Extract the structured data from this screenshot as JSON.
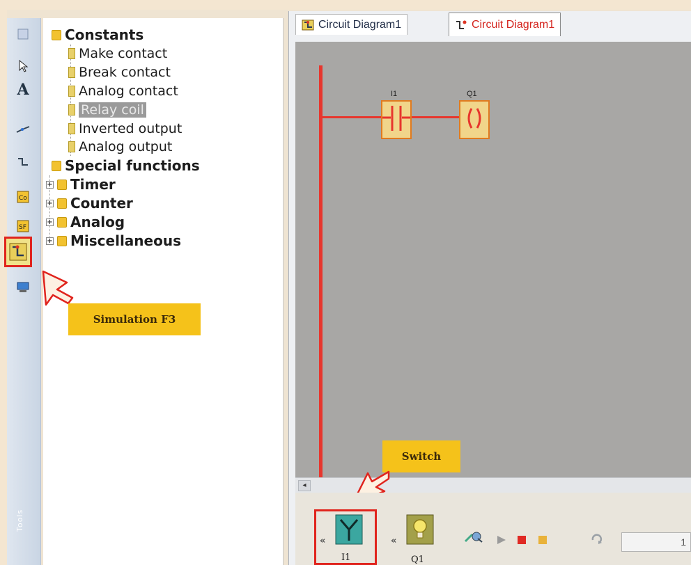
{
  "tabs": [
    {
      "label": "Circuit Diagram1",
      "active": false
    },
    {
      "label": "Circuit Diagram1",
      "active": true
    }
  ],
  "toolbar": {
    "tools_label": "Tools",
    "icons": [
      "select-icon",
      "pointer-icon",
      "text-icon",
      "connect-icon",
      "split-icon",
      "constants-icon",
      "special-functions-icon",
      "simulation-icon",
      "online-test-icon"
    ]
  },
  "tree": {
    "constants": "Constants",
    "items": [
      {
        "label": "Make contact",
        "highlighted": false
      },
      {
        "label": "Break contact",
        "highlighted": false
      },
      {
        "label": "Analog contact",
        "highlighted": false
      },
      {
        "label": "Relay coil",
        "highlighted": true
      },
      {
        "label": "Inverted output",
        "highlighted": false
      },
      {
        "label": "Analog output",
        "highlighted": false
      }
    ],
    "special_functions": "Special functions",
    "groups": [
      "Timer",
      "Counter",
      "Analog",
      "Miscellaneous"
    ]
  },
  "diagram": {
    "contact_label": "I1",
    "coil_label": "Q1",
    "contact_symbol": "-||-",
    "coil_symbol": "( )",
    "wire_color": "#e7362d"
  },
  "callouts": {
    "simulation": "Simulation F3",
    "switch": "Switch"
  },
  "simbar": {
    "input_name": "I1",
    "output_name": "Q1",
    "counter_value": "1"
  },
  "colors": {
    "accent_red": "#e0241d",
    "callout_yellow": "#f5c21a",
    "canvas_gray": "#a8a7a5"
  }
}
